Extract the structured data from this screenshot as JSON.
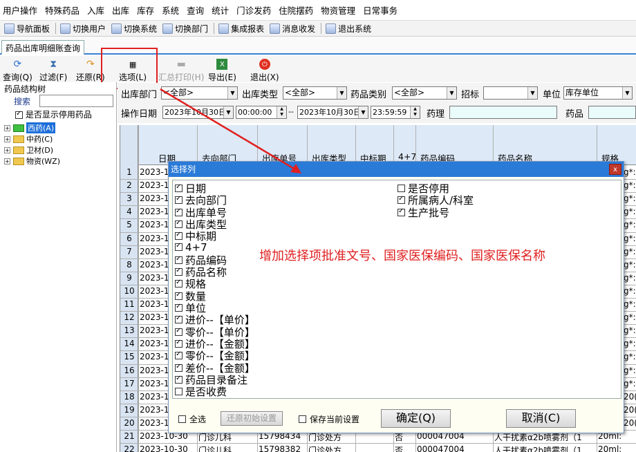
{
  "menu": [
    "用户操作",
    "特殊药品",
    "入库",
    "出库",
    "库存",
    "系统",
    "查询",
    "统计",
    "门诊发药",
    "住院摆药",
    "物资管理",
    "日常事务"
  ],
  "toolbar": [
    "导航面板",
    "切换用户",
    "切换系统",
    "切换部门",
    "集成报表",
    "消息收发",
    "退出系统"
  ],
  "tab": "药品出库明细账查询",
  "actions": {
    "query": "查询(Q)",
    "filter": "过滤(F)",
    "restore": "还原(R)",
    "options": "选项(L)",
    "summary_print": "汇总打印(H)",
    "export": "导出(E)",
    "exit": "退出(X)"
  },
  "tree": {
    "title": "药品结构树",
    "search_label": "搜索",
    "show_disabled": "是否显示停用药品",
    "items": [
      "西药(A)",
      "中药(C)",
      "卫材(D)",
      "物资(WZ)"
    ]
  },
  "filters": {
    "dept_label": "出库部门",
    "dept_value": "<全部>",
    "type_label": "出库类型",
    "type_value": "<全部>",
    "category_label": "药品类别",
    "category_value": "<全部>",
    "bid_label": "招标",
    "bid_value": "",
    "unit_label": "单位",
    "unit_value": "库存单位",
    "date_label": "操作日期",
    "start_date": "2023年10月30日",
    "start_time": "00:00:00",
    "range_sep": "--",
    "end_date": "2023年10月30日",
    "end_time": "23:59:59",
    "pharm_label": "药理",
    "drug_label": "药品"
  },
  "grid": {
    "headers": [
      "日期",
      "去向部门",
      "出库单号",
      "出库类型",
      "中标期",
      "4+7",
      "药品编码",
      "药品名称",
      "规格"
    ],
    "row_numbers": [
      "1",
      "2",
      "3",
      "4",
      "5",
      "6",
      "7",
      "8",
      "9",
      "10",
      "11",
      "12",
      "13",
      "14",
      "15",
      "16",
      "17",
      "18",
      "19",
      "20",
      "21",
      "22"
    ],
    "date_clip": "2023-10",
    "spec_clip": [
      "g*:",
      "g*:",
      "g*:",
      "g*:",
      "g*:",
      "g*:",
      "g*:",
      "g*:",
      "g*:",
      "g*:",
      "g*:",
      "g*:",
      "g*:",
      "g*:",
      "g*:",
      "g*:",
      "g*:",
      "20(",
      "20(",
      "20("
    ],
    "row21": [
      "2023-10-30",
      "门诊儿科",
      "15798434",
      "门诊处方",
      "",
      "否",
      "000047004",
      "人干扰素α2b喷雾剂（1",
      "20ml:"
    ],
    "row22": [
      "2023-10-30",
      "门诊儿科",
      "15798382",
      "门诊处方",
      "",
      "否",
      "000047004",
      "人干扰素α2b喷雾剂（1",
      "20ml:"
    ]
  },
  "dialog": {
    "title": "选择列",
    "close": "x",
    "left_options": [
      {
        "label": "日期",
        "checked": true
      },
      {
        "label": "去向部门",
        "checked": true
      },
      {
        "label": "出库单号",
        "checked": true
      },
      {
        "label": "出库类型",
        "checked": true
      },
      {
        "label": "中标期",
        "checked": true
      },
      {
        "label": "4+7",
        "checked": true
      },
      {
        "label": "药品编码",
        "checked": true
      },
      {
        "label": "药品名称",
        "checked": true
      },
      {
        "label": "规格",
        "checked": true
      },
      {
        "label": "数量",
        "checked": true
      },
      {
        "label": "单位",
        "checked": true
      },
      {
        "label": "进价--【单价】",
        "checked": true
      },
      {
        "label": "零价--【单价】",
        "checked": true
      },
      {
        "label": "进价--【金额】",
        "checked": true
      },
      {
        "label": "零价--【金额】",
        "checked": true
      },
      {
        "label": "差价--【金额】",
        "checked": true
      },
      {
        "label": "药品目录备注",
        "checked": true
      },
      {
        "label": "是否收费",
        "checked": false
      }
    ],
    "right_options": [
      {
        "label": "是否停用",
        "checked": false
      },
      {
        "label": "所属病人/科室",
        "checked": true
      },
      {
        "label": "生产批号",
        "checked": true
      }
    ],
    "note": "增加选择项批准文号、国家医保编码、国家医保名称",
    "select_all": "全选",
    "restore_defaults": "还原初始设置",
    "save_settings": "保存当前设置",
    "ok": "确定(Q)",
    "cancel": "取消(C)"
  },
  "colors": {
    "accent": "#2a7ad8",
    "highlight": "#e02020"
  }
}
